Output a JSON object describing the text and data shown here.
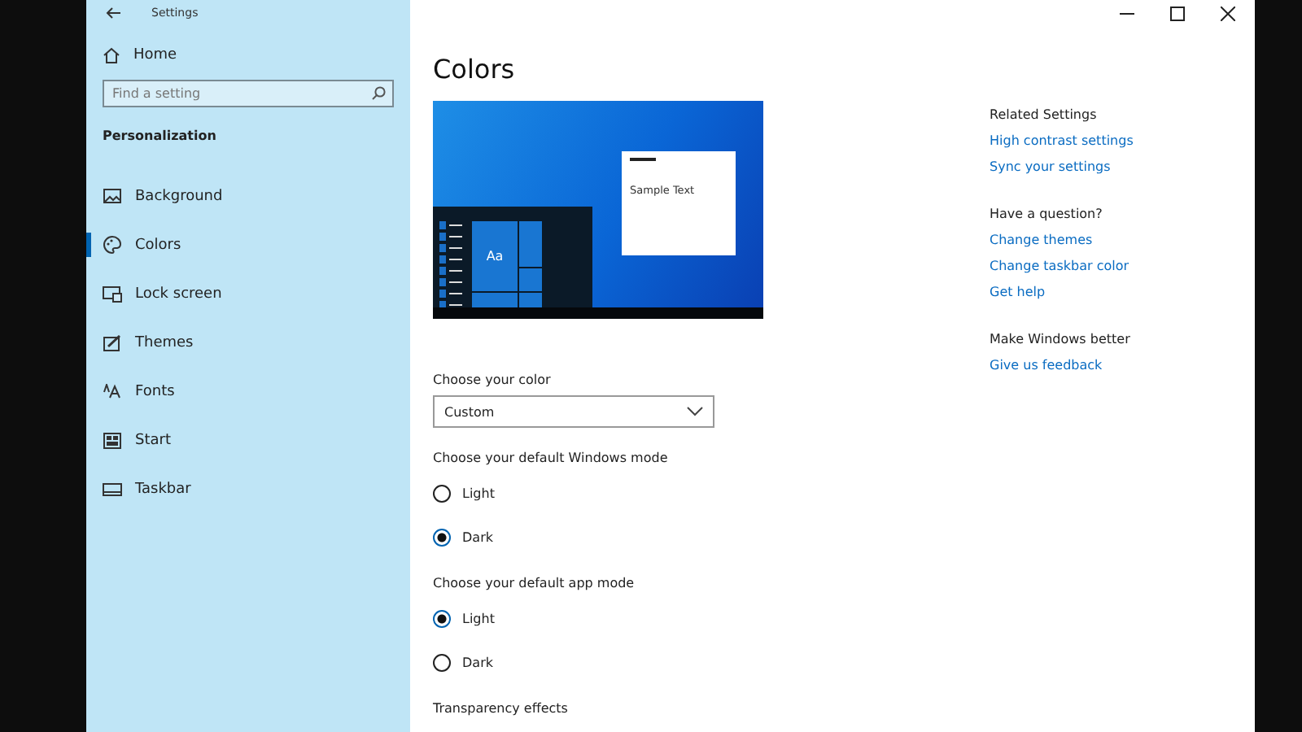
{
  "window": {
    "title": "Settings"
  },
  "sidebar": {
    "home": "Home",
    "search": {
      "placeholder": "Find a setting"
    },
    "section": "Personalization",
    "items": [
      {
        "label": "Background",
        "selected": false
      },
      {
        "label": "Colors",
        "selected": true
      },
      {
        "label": "Lock screen",
        "selected": false
      },
      {
        "label": "Themes",
        "selected": false
      },
      {
        "label": "Fonts",
        "selected": false
      },
      {
        "label": "Start",
        "selected": false
      },
      {
        "label": "Taskbar",
        "selected": false
      }
    ]
  },
  "page": {
    "title": "Colors",
    "preview": {
      "sample_text": "Sample Text",
      "tile_text": "Aa"
    },
    "color_choice": {
      "label": "Choose your color",
      "value": "Custom"
    },
    "radio_groups": [
      {
        "label": "Choose your default Windows mode",
        "options": [
          {
            "label": "Light",
            "selected": false
          },
          {
            "label": "Dark",
            "selected": true
          }
        ]
      },
      {
        "label": "Choose your default app mode",
        "options": [
          {
            "label": "Light",
            "selected": true
          },
          {
            "label": "Dark",
            "selected": false
          }
        ]
      }
    ],
    "next_section": "Transparency effects"
  },
  "related": [
    {
      "heading": "Related Settings",
      "links": [
        "High contrast settings",
        "Sync your settings"
      ]
    },
    {
      "heading": "Have a question?",
      "links": [
        "Change themes",
        "Change taskbar color",
        "Get help"
      ]
    },
    {
      "heading": "Make Windows better",
      "links": [
        "Give us feedback"
      ]
    }
  ]
}
